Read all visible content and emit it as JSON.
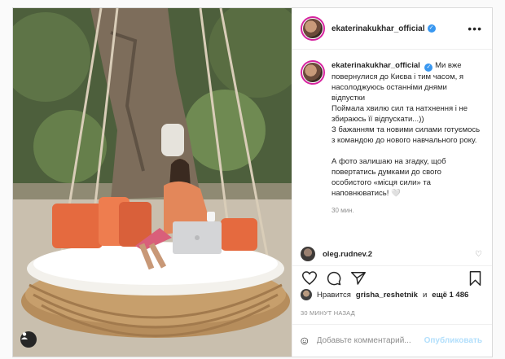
{
  "post": {
    "username": "ekaterinakukhar_official",
    "verified_mark": "✓",
    "more_glyph": "•••",
    "caption": {
      "username": "ekaterinakukhar_official",
      "lines": [
        "Ми вже повернулися до Києва і тим часом, я насолоджуюсь останніми днями відпустки",
        "Поймала хвилю сил та натхнення і не збираюсь її відпускати...))",
        "З бажанням та новими силами готуємось з командою до нового навчального року."
      ],
      "lines_after_gap": [
        "А фото залишаю на згадку, щоб повертатись думками до свого особистого «місця сили» та наповнюватись! 🤍"
      ],
      "time": "30 мин."
    },
    "comment_preview": {
      "username": "oleg.rudnev.2",
      "text": "...",
      "heart": "♡"
    },
    "likes": {
      "prefix": "Нравится",
      "user": "grisha_reshetnik",
      "middle": "и",
      "count": "ещё 1 486"
    },
    "ago": "30 МИНУТ НАЗАД",
    "add_comment": {
      "placeholder": "Добавьте комментарий...",
      "publish_label": "Опубликовать"
    },
    "icons": [
      "heart-icon",
      "comment-icon",
      "share-icon",
      "bookmark-icon",
      "emoji-icon",
      "user-tag-icon",
      "more-icon",
      "verified-icon"
    ],
    "colors": {
      "verified": "#3897f0",
      "publish_disabled": "#b2dffc",
      "muted": "#8e8e8e"
    }
  }
}
